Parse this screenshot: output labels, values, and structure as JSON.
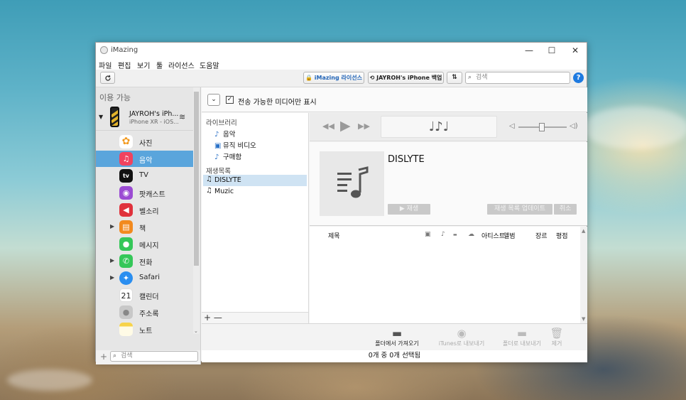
{
  "window": {
    "title": "iMazing"
  },
  "window_controls": {
    "minimize": "—",
    "maximize": "☐",
    "close": "✕"
  },
  "menu": [
    "파일",
    "편집",
    "보기",
    "툴",
    "라이선스",
    "도움말"
  ],
  "toolbar": {
    "refresh_icon": "refresh-icon",
    "license_label": "iMazing 라이선스",
    "backup_label": "JAYROH's iPhone 백업",
    "search_placeholder": "검색",
    "help_label": "?"
  },
  "sidebar": {
    "heading": "이용 가능",
    "device": {
      "name": "JAYROH's iPh...",
      "model": "iPhone XR - iOS..."
    },
    "items": [
      {
        "label": "사진",
        "icon": "photos-icon",
        "color": "#ffffff",
        "expandable": false
      },
      {
        "label": "음악",
        "icon": "music-icon",
        "color": "#f0435f",
        "expandable": false,
        "selected": true
      },
      {
        "label": "TV",
        "icon": "tv-icon",
        "color": "#111111",
        "expandable": false
      },
      {
        "label": "팟캐스트",
        "icon": "podcasts-icon",
        "color": "#9b4bd3",
        "expandable": false
      },
      {
        "label": "벨소리",
        "icon": "ringtones-icon",
        "color": "#e0323c",
        "expandable": false
      },
      {
        "label": "책",
        "icon": "books-icon",
        "color": "#f28a1e",
        "expandable": true
      },
      {
        "label": "메시지",
        "icon": "messages-icon",
        "color": "#35c759",
        "expandable": false
      },
      {
        "label": "전화",
        "icon": "phone-icon",
        "color": "#35c759",
        "expandable": true
      },
      {
        "label": "Safari",
        "icon": "safari-icon",
        "color": "#2a8ef0",
        "expandable": true
      },
      {
        "label": "캘린더",
        "icon": "calendar-icon",
        "color": "#ffffff",
        "expandable": false,
        "glyph": "21"
      },
      {
        "label": "주소록",
        "icon": "contacts-icon",
        "color": "#c8c8c8",
        "expandable": false
      },
      {
        "label": "노트",
        "icon": "notes-icon",
        "color": "#f7d34a",
        "expandable": false
      }
    ],
    "search_placeholder": "검색",
    "add_label": "+"
  },
  "filter": {
    "checked": true,
    "label": "전송 가능한 미디어만 표시"
  },
  "library": {
    "heading": "라이브러리",
    "items": [
      {
        "label": "음악",
        "icon": "note-icon"
      },
      {
        "label": "뮤직 비디오",
        "icon": "video-icon"
      },
      {
        "label": "구매함",
        "icon": "purchased-icon"
      }
    ],
    "playlists_heading": "재생목록",
    "playlists": [
      {
        "label": "DISLYTE",
        "selected": true
      },
      {
        "label": "Muzic",
        "selected": false
      }
    ],
    "footer": "+ —"
  },
  "player": {
    "lcd_glyph": "♩♪♩",
    "volume": 0.48
  },
  "album": {
    "title": "DISLYTE",
    "play_label": "▶  재생",
    "update_label": "재생 목록 업데이트",
    "cancel_label": "취소"
  },
  "table": {
    "columns": [
      "제목",
      "아티스트",
      "앨범",
      "장르",
      "평점"
    ]
  },
  "actions": [
    {
      "label": "폴더에서 가져오기",
      "icon": "folder-icon",
      "enabled": true
    },
    {
      "label": "iTunes로 내보내기",
      "icon": "itunes-icon",
      "enabled": false
    },
    {
      "label": "폴더로 내보내기",
      "icon": "folder-export-icon",
      "enabled": false
    },
    {
      "label": "제거",
      "icon": "trash-icon",
      "enabled": false
    }
  ],
  "status": "0개 중 0개 선택됨"
}
